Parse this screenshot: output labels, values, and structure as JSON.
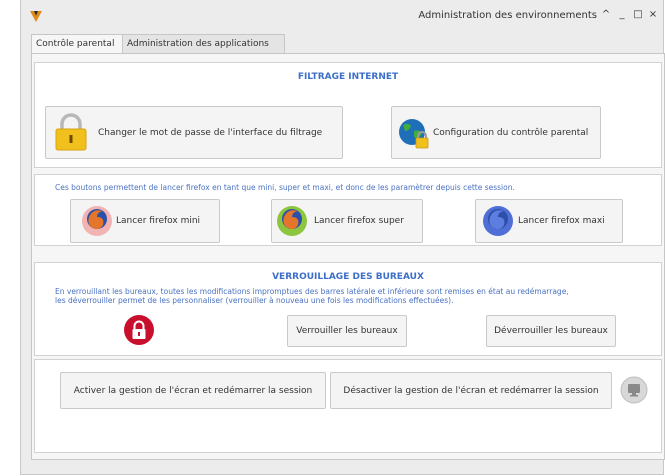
{
  "window": {
    "title": "Administration des environnements",
    "controls": [
      "^",
      "_",
      "□",
      "×"
    ]
  },
  "tabs": [
    {
      "label": "Contrôle parental",
      "active": true
    },
    {
      "label": "Administration des applications",
      "active": false
    }
  ],
  "filtering": {
    "heading": "FILTRAGE INTERNET",
    "change_password_label": "Changer le mot de passe de l'interface du filtrage",
    "config_label": "Configuration du contrôle parental"
  },
  "firefox": {
    "info": "Ces boutons permettent de lancer firefox en tant que mini, super et maxi, et donc de les paramètrer depuis cette session.",
    "mini_label": "Lancer firefox mini",
    "super_label": "Lancer firefox super",
    "maxi_label": "Lancer firefox maxi"
  },
  "lock": {
    "heading": "VERROUILLAGE DES BUREAUX",
    "info_line1": "En verrouillant les bureaux, toutes les modifications impromptues des barres latérale et inférieure sont remises en état au redémarrage,",
    "info_line2": "les déverrouiller permet de les personnaliser (verrouiller à nouveau une fois les modifications effectuées).",
    "lock_label": "Verrouiller les bureaux",
    "unlock_label": "Déverrouiller les bureaux"
  },
  "screen": {
    "activate_label": "Activer la gestion de l'écran et redémarrer la session",
    "deactivate_label": "Désactiver la gestion de l'écran et redémarrer la session"
  },
  "colors": {
    "accent": "#3d6fc9",
    "lock_red": "#c8102e",
    "padlock_yellow": "#f2c01c"
  }
}
